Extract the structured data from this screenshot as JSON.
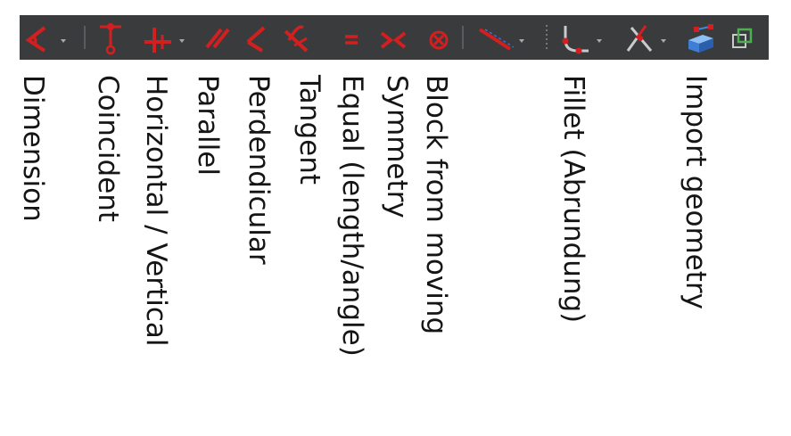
{
  "toolbar": {
    "buttons": [
      {
        "icon": "dimension-icon",
        "has_dropdown": true
      },
      {
        "icon": "coincident-icon",
        "has_dropdown": false
      },
      {
        "icon": "horizontal-vertical-icon",
        "has_dropdown": true
      },
      {
        "icon": "parallel-icon",
        "has_dropdown": false
      },
      {
        "icon": "perpendicular-icon",
        "has_dropdown": false
      },
      {
        "icon": "tangent-icon",
        "has_dropdown": false
      },
      {
        "icon": "equal-icon",
        "has_dropdown": false
      },
      {
        "icon": "symmetry-icon",
        "has_dropdown": false
      },
      {
        "icon": "block-icon",
        "has_dropdown": false
      },
      {
        "icon": "external-geometry-icon",
        "has_dropdown": true
      },
      {
        "icon": "fillet-icon",
        "has_dropdown": true
      },
      {
        "icon": "trim-icon",
        "has_dropdown": true
      },
      {
        "icon": "import-geometry-icon",
        "has_dropdown": false
      },
      {
        "icon": "sketch-view-icon",
        "has_dropdown": false
      }
    ]
  },
  "labels": {
    "dimension": "Dimension",
    "coincident": "Coincident",
    "horizontal_vertical": "Horizontal / Vertical",
    "parallel": "Parallel",
    "perpendicular": "Perdendicular",
    "tangent": "Tangent",
    "equal": "Equal (length/angle)",
    "symmetry": "Symmetry",
    "block": "Block from moving",
    "fillet": "Fillet (Abrundung)",
    "import_geometry": "Import geometry"
  },
  "colors": {
    "toolbar_bg": "#3a3b3d",
    "constraint_red": "#d31f1f",
    "dropdown_arrow": "#a7a8aa",
    "label_text": "#151515",
    "import_blue": "#4f8fe0"
  }
}
